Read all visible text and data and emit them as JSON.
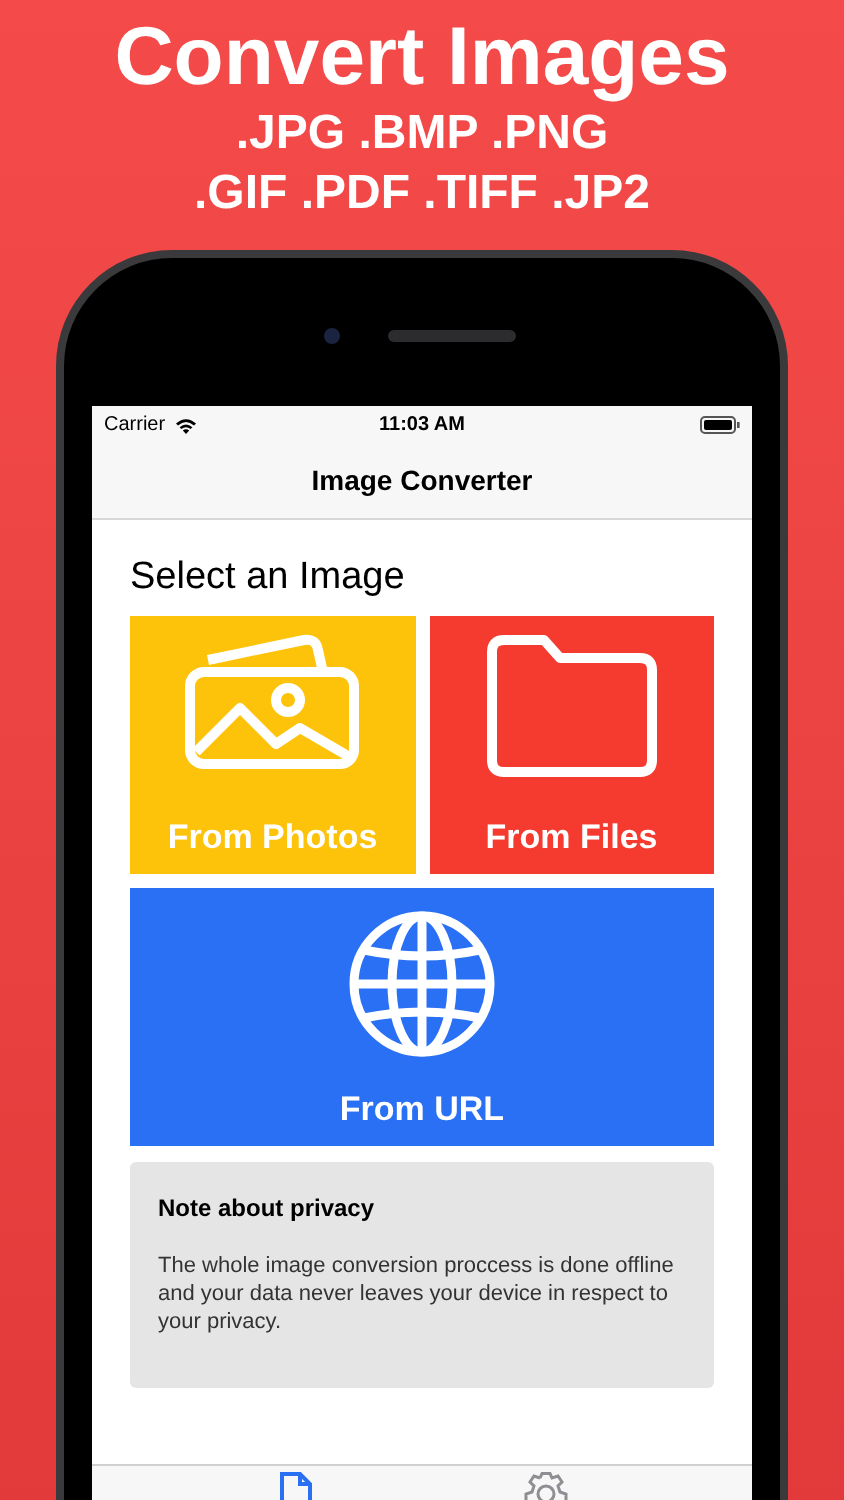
{
  "headline": {
    "title": "Convert Images",
    "formats": [
      ".JPG .BMP .PNG",
      ".GIF .PDF .TIFF .JP2"
    ]
  },
  "status_bar": {
    "carrier": "Carrier",
    "time": "11:03 AM"
  },
  "nav_bar": {
    "title": "Image Converter"
  },
  "section_title": "Select an Image",
  "sources": [
    {
      "kind": "photos",
      "label": "From Photos",
      "color": "#fdc20a"
    },
    {
      "kind": "files",
      "label": "From Files",
      "color": "#f53b30"
    },
    {
      "kind": "url",
      "label": "From URL",
      "color": "#2a70f5"
    }
  ],
  "note": {
    "title": "Note about privacy",
    "body": "The whole image conversion proccess is done offline and your data never leaves your device in respect to your privacy."
  },
  "tab_bar": [
    {
      "kind": "document",
      "selected": true
    },
    {
      "kind": "settings",
      "selected": false
    }
  ]
}
